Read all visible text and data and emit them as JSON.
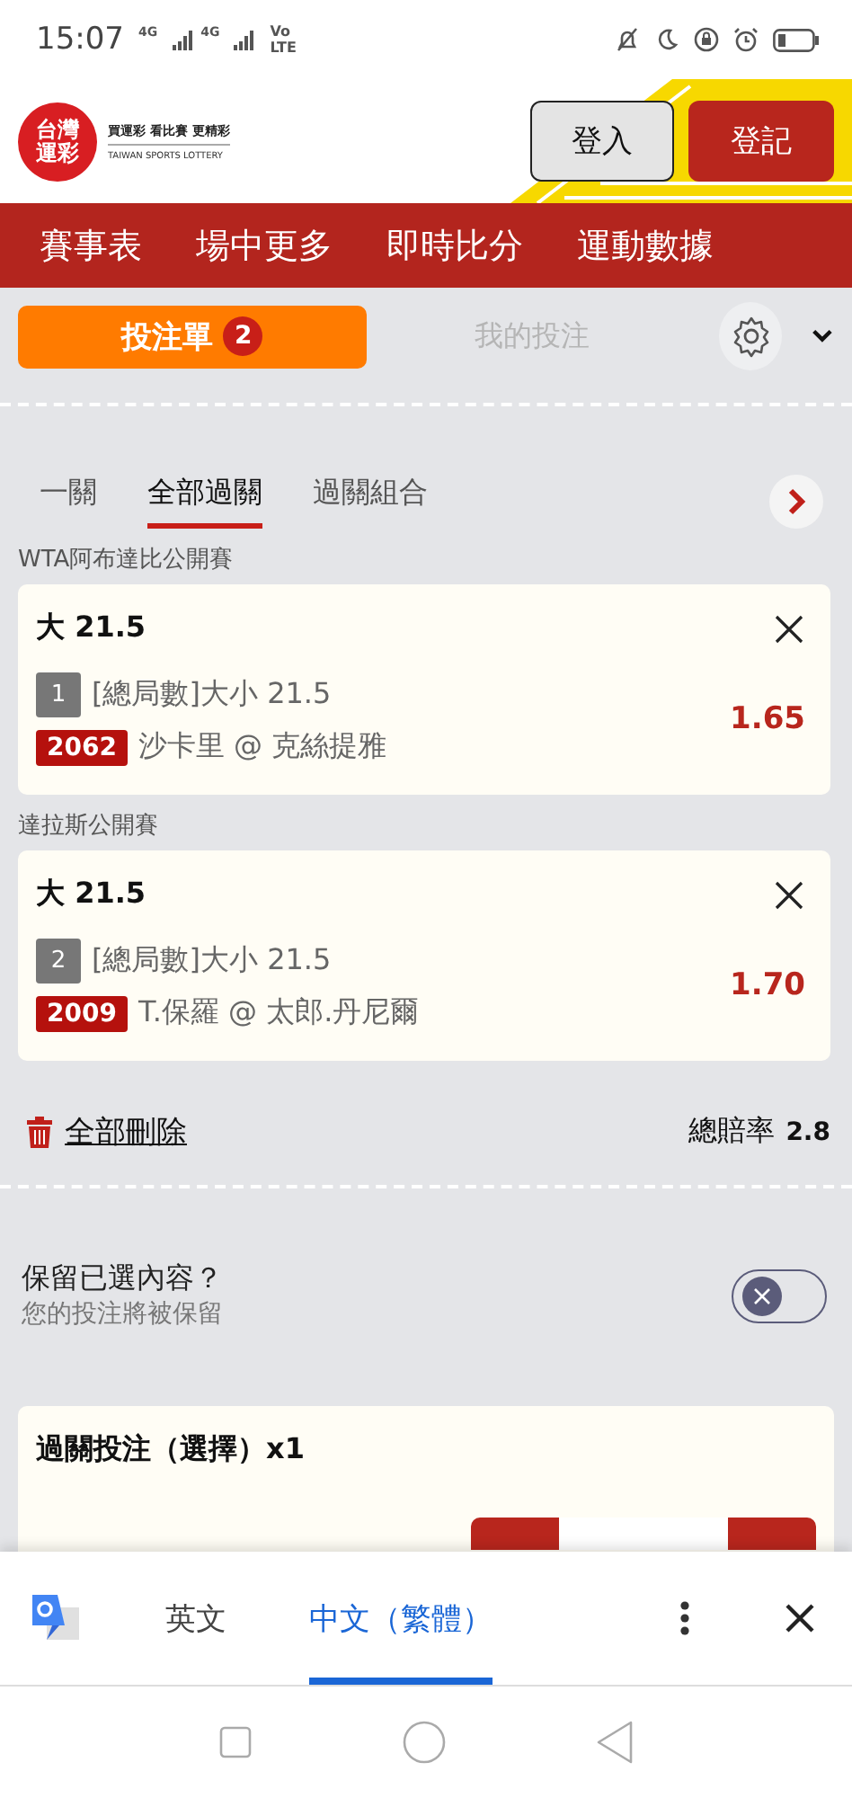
{
  "status_bar": {
    "time": "15:07",
    "network": [
      "4G",
      "4G"
    ],
    "volte": [
      "Vo",
      "LTE"
    ]
  },
  "header": {
    "logo": {
      "mark": [
        "台灣",
        "運彩"
      ],
      "slogan": "買運彩 看比賽 更精彩",
      "english": "TAIWAN SPORTS LOTTERY"
    },
    "buttons": [
      {
        "label": "登入",
        "kind": "outline"
      },
      {
        "label": "登記",
        "kind": "primary"
      }
    ]
  },
  "nav": [
    "賽事表",
    "場中更多",
    "即時比分",
    "運動數據"
  ],
  "bet_tabs": [
    {
      "label": "投注單",
      "badge": "2",
      "selected": true
    },
    {
      "label": "我的投注",
      "selected": false
    }
  ],
  "parlay_tabs": [
    {
      "label": "一關",
      "selected": false
    },
    {
      "label": "全部過關",
      "selected": true
    },
    {
      "label": "過關組合",
      "selected": false
    }
  ],
  "bets": [
    {
      "competition": "WTA阿布達比公開賽",
      "pick": "大 21.5",
      "number": "1",
      "market": "[總局數]大小 21.5",
      "code": "2062",
      "match": "沙卡里 @ 克絲提雅",
      "odds": "1.65"
    },
    {
      "competition": "達拉斯公開賽",
      "pick": "大 21.5",
      "number": "2",
      "market": "[總局數]大小 21.5",
      "code": "2009",
      "match": "T.保羅 @ 太郎.丹尼爾",
      "odds": "1.70"
    }
  ],
  "summary": {
    "delete_all": "全部刪除",
    "total_odds_label": "總賠率",
    "total_odds": "2.8"
  },
  "keep_selection": {
    "title": "保留已選內容？",
    "subtitle": "您的投注將被保留",
    "on": false
  },
  "parlay_card": {
    "title": "過關投注（選擇）x1"
  },
  "translate_bar": {
    "languages": [
      {
        "label": "英文",
        "selected": false
      },
      {
        "label": "中文（繁體）",
        "selected": true
      }
    ]
  }
}
